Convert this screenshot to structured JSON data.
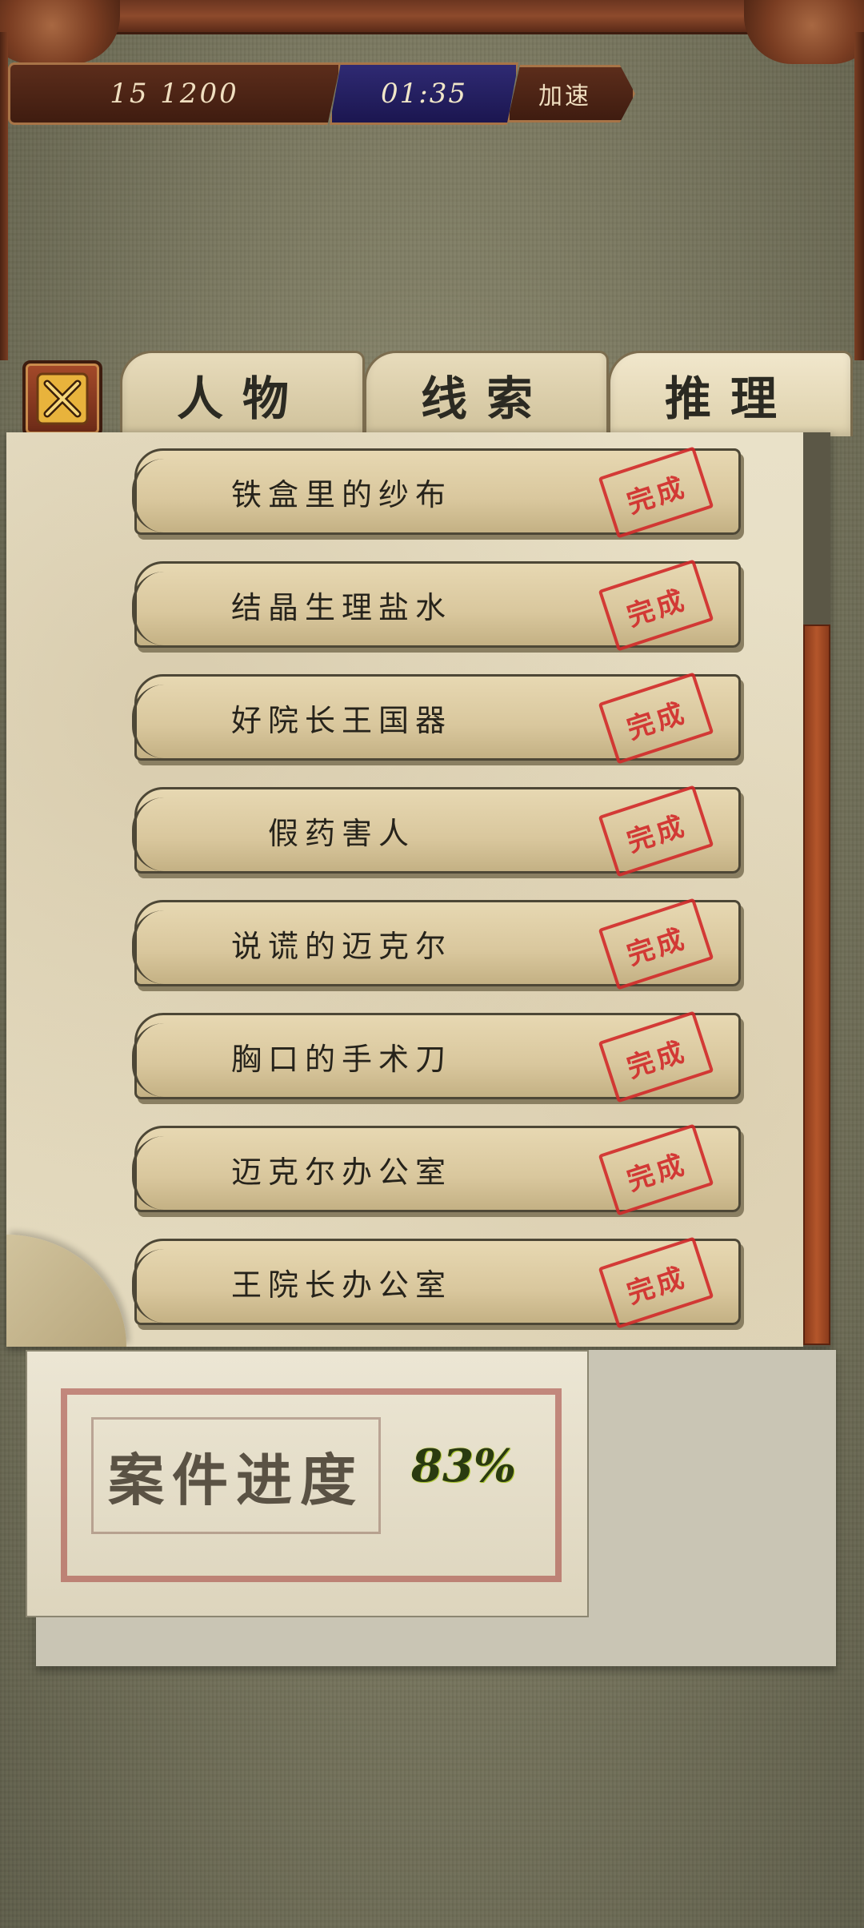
{
  "status": {
    "money": "15 1200",
    "time": "01:35",
    "speed_label": "加速"
  },
  "tabs": [
    {
      "label": "人物"
    },
    {
      "label": "线索"
    },
    {
      "label": "推理"
    }
  ],
  "active_tab": "推理",
  "items": [
    {
      "label": "铁盒里的纱布",
      "stamp": "完成"
    },
    {
      "label": "结晶生理盐水",
      "stamp": "完成"
    },
    {
      "label": "好院长王国器",
      "stamp": "完成"
    },
    {
      "label": "假药害人",
      "stamp": "完成"
    },
    {
      "label": "说谎的迈克尔",
      "stamp": "完成"
    },
    {
      "label": "胸口的手术刀",
      "stamp": "完成"
    },
    {
      "label": "迈克尔办公室",
      "stamp": "完成"
    },
    {
      "label": "王院长办公室",
      "stamp": "完成"
    }
  ],
  "progress": {
    "label": "案件进度",
    "value": "83%"
  },
  "colors": {
    "stamp": "#d22a2a",
    "frame": "#7a3d22",
    "scroll_thumb": "#b4562b"
  }
}
